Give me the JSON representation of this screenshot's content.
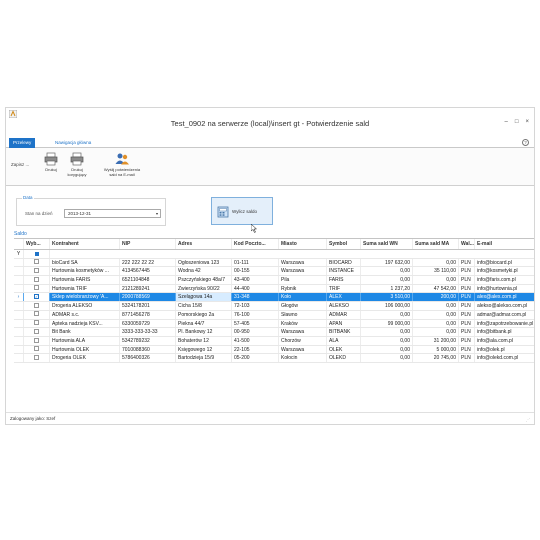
{
  "window": {
    "title": "Test_0902 na serwerze (local)\\insert gt - Potwierdzenie sald",
    "controls": [
      "–",
      "□",
      "×"
    ]
  },
  "ribbon": {
    "tabs": [
      "Przelewy",
      "Nawigacja główna"
    ],
    "group_label": "Zapisz ...",
    "buttons": [
      {
        "label": "Drukuj",
        "icon": "printer-icon"
      },
      {
        "label": "Drukuj\nkorygujący",
        "icon": "printer-icon"
      },
      {
        "label": "Wyślij potwierdzenia\nsald na E-mail",
        "icon": "users-email-icon"
      }
    ],
    "help": "?"
  },
  "date_filter": {
    "legend": "Data",
    "label": "Stan na dzień",
    "value": "2013-12-31"
  },
  "calc_button": {
    "label": "Wylicz saldo"
  },
  "section_label": "Saldo",
  "table": {
    "columns": [
      "Wyb...",
      "Kontrahent",
      "NIP",
      "Adres",
      "Kod Poczto...",
      "Miasto",
      "Symbol",
      "Suma sald WN",
      "Suma sald MA",
      "Wal...",
      "E-mail"
    ],
    "filter_row_marker": "Y",
    "rows": [
      {
        "checked": false,
        "name": "bioCard SA",
        "nip": "222 222 22 22",
        "address": "Ogłoszeniowa 123",
        "zip": "01-111",
        "city": "Warszawa",
        "symbol": "BIOCARD",
        "wn": "197 632,00",
        "ma": "0,00",
        "cur": "PLN",
        "email": "info@biocard.pl"
      },
      {
        "checked": false,
        "name": "Hurtownia kosmetyków ...",
        "nip": "4134567445",
        "address": "Wodna 42",
        "zip": "00-155",
        "city": "Warszawa",
        "symbol": "INSTANCE",
        "wn": "0,00",
        "ma": "35 110,00",
        "cur": "PLN",
        "email": "info@kosmetyki.pl"
      },
      {
        "checked": false,
        "name": "Hurtownia FARIS",
        "nip": "6521104848",
        "address": "Pszczyńskiego 48a/7",
        "zip": "43-400",
        "city": "Pila",
        "symbol": "FARIS",
        "wn": "0,00",
        "ma": "0,00",
        "cur": "PLN",
        "email": "info@faris.com.pl"
      },
      {
        "checked": false,
        "name": "Hurtownia TRIF",
        "nip": "2121289241",
        "address": "Zwierzyńska 90/22",
        "zip": "44-400",
        "city": "Rybnik",
        "symbol": "TRIF",
        "wn": "1 237,20",
        "ma": "47 542,00",
        "cur": "PLN",
        "email": "info@hurtownia.pl"
      },
      {
        "checked": true,
        "selected": true,
        "name": "Sklep wielobranżowy 'A...",
        "nip": "2000788569",
        "address": "Szelągowa 14a",
        "zip": "31-348",
        "city": "Koło",
        "symbol": "ALEX",
        "wn": "3 510,00",
        "ma": "200,00",
        "cur": "PLN",
        "email": "alex@alex.com.pl"
      },
      {
        "checked": false,
        "name": "Drogeria ALEKSO",
        "nip": "5324178201",
        "address": "Cicha 15/8",
        "zip": "72-103",
        "city": "Głogów",
        "symbol": "ALEKSO",
        "wn": "106 000,00",
        "ma": "0,00",
        "cur": "PLN",
        "email": "alekso@alekso.com.pl"
      },
      {
        "checked": false,
        "name": "ADMAR s.c.",
        "nip": "8771456278",
        "address": "Pomorskiego 2a",
        "zip": "76-100",
        "city": "Sławno",
        "symbol": "ADMAR",
        "wn": "0,00",
        "ma": "0,00",
        "cur": "PLN",
        "email": "admar@admar.com.pl"
      },
      {
        "checked": false,
        "name": "Apteka nadzieja KSV...",
        "nip": "6330059729",
        "address": "Piekna 44/7",
        "zip": "57-405",
        "city": "Kraków",
        "symbol": "APAN",
        "wn": "99 000,00",
        "ma": "0,00",
        "cur": "PLN",
        "email": "info@zapotrzebowanie.pl"
      },
      {
        "checked": false,
        "name": "Bit Bank",
        "nip": "3333-333-33-33",
        "address": "Pl. Bankowy 12",
        "zip": "00-950",
        "city": "Warszawa",
        "symbol": "BITBANK",
        "wn": "0,00",
        "ma": "0,00",
        "cur": "PLN",
        "email": "info@bitbank.pl"
      },
      {
        "checked": false,
        "name": "Hurtownia ALA",
        "nip": "5342789232",
        "address": "Bohaterów 12",
        "zip": "41-500",
        "city": "Chorzów",
        "symbol": "ALA",
        "wn": "0,00",
        "ma": "31 200,00",
        "cur": "PLN",
        "email": "info@ala.com.pl"
      },
      {
        "checked": false,
        "name": "Hurtownia OLEK",
        "nip": "7010088360",
        "address": "Księgowego 12",
        "zip": "22-105",
        "city": "Warszawa",
        "symbol": "OLEK",
        "wn": "0,00",
        "ma": "5 000,00",
        "cur": "PLN",
        "email": "info@olek.pl"
      },
      {
        "checked": false,
        "name": "Drogeria OLEK",
        "nip": "5786400326",
        "address": "Bartodzieja 15/9",
        "zip": "05-200",
        "city": "Kołocin",
        "symbol": "OLEKD",
        "wn": "0,00",
        "ma": "20 745,00",
        "cur": "PLN",
        "email": "info@olekd.com.pl"
      }
    ]
  },
  "statusbar": {
    "text": "Zalogowany jako: Szef"
  }
}
